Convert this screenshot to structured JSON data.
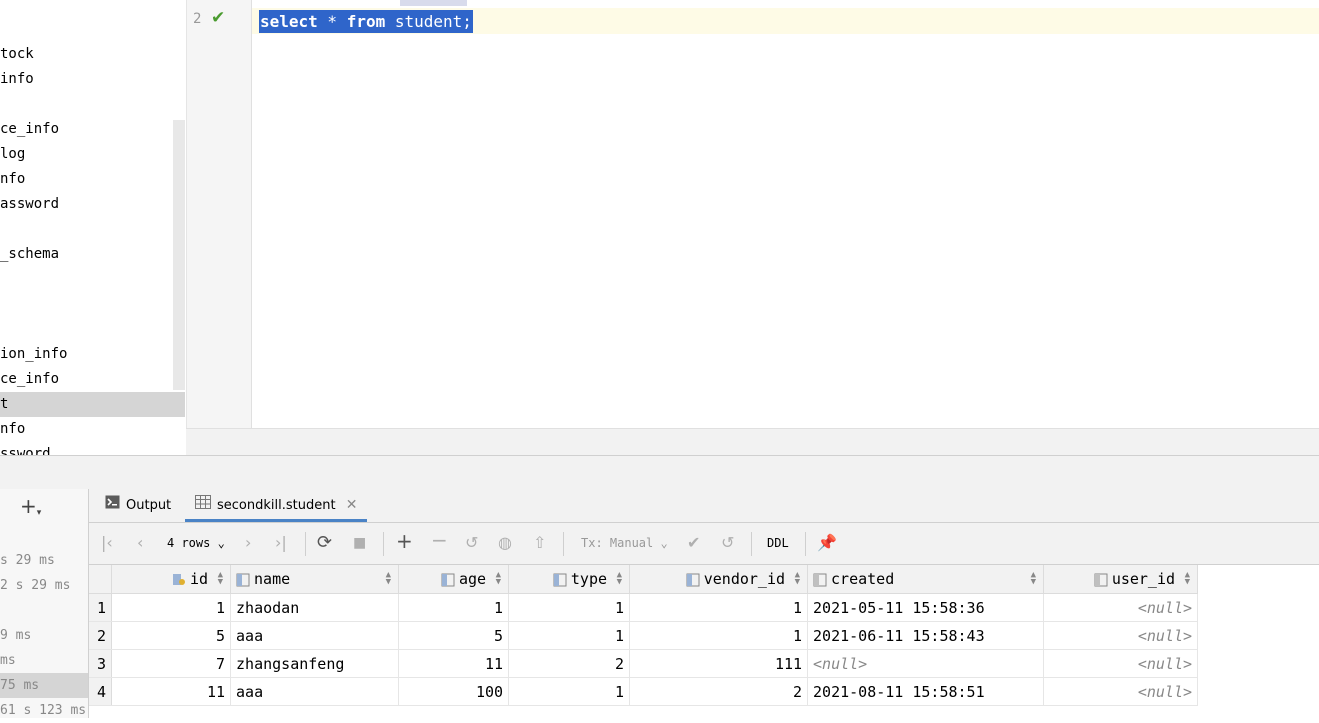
{
  "tree": {
    "items": [
      {
        "label": "tock",
        "selected": false
      },
      {
        "label": "info",
        "selected": false
      },
      {
        "label": "",
        "selected": false
      },
      {
        "label": "ce_info",
        "selected": false
      },
      {
        "label": "log",
        "selected": false
      },
      {
        "label": "nfo",
        "selected": false
      },
      {
        "label": "assword",
        "selected": false
      },
      {
        "label": "",
        "selected": false
      },
      {
        "label": "_schema",
        "selected": false
      },
      {
        "label": "",
        "selected": false
      },
      {
        "label": "",
        "selected": false
      },
      {
        "label": "",
        "selected": false
      },
      {
        "label": "ion_info",
        "selected": false
      },
      {
        "label": "ce_info",
        "selected": false
      },
      {
        "label": "t",
        "selected": true
      },
      {
        "label": "nfo",
        "selected": false
      },
      {
        "label": "ssword",
        "selected": false
      }
    ]
  },
  "editor": {
    "line_number": "2",
    "code": {
      "kw1": "select",
      "star": " * ",
      "kw2": "from",
      "rest": " student;"
    }
  },
  "services": {
    "times": [
      {
        "label": "",
        "selected": false
      },
      {
        "label": "s 29 ms",
        "selected": false
      },
      {
        "label": "2 s 29 ms",
        "selected": false
      },
      {
        "label": "",
        "selected": false
      },
      {
        "label": "9 ms",
        "selected": false
      },
      {
        "label": "ms",
        "selected": false
      },
      {
        "label": "75 ms",
        "selected": true
      },
      {
        "label": "61 s 123 ms",
        "selected": false
      }
    ]
  },
  "tabs": {
    "output": "Output",
    "result": "secondkill.student"
  },
  "toolbar": {
    "rows": "4 rows",
    "tx": "Tx: Manual",
    "ddl": "DDL"
  },
  "grid": {
    "columns": [
      "id",
      "name",
      "age",
      "type",
      "vendor_id",
      "created",
      "user_id"
    ],
    "rows": [
      {
        "n": "1",
        "id": "1",
        "name": "zhaodan",
        "age": "1",
        "type": "1",
        "vendor_id": "1",
        "created": "2021-05-11 15:58:36",
        "user_id": "<null>"
      },
      {
        "n": "2",
        "id": "5",
        "name": "aaa",
        "age": "5",
        "type": "1",
        "vendor_id": "1",
        "created": "2021-06-11 15:58:43",
        "user_id": "<null>"
      },
      {
        "n": "3",
        "id": "7",
        "name": "zhangsanfeng",
        "age": "11",
        "type": "2",
        "vendor_id": "111",
        "created": "<null>",
        "user_id": "<null>"
      },
      {
        "n": "4",
        "id": "11",
        "name": "aaa",
        "age": "100",
        "type": "1",
        "vendor_id": "2",
        "created": "2021-08-11 15:58:51",
        "user_id": "<null>"
      }
    ]
  },
  "colors": {
    "selection": "#2f65ca",
    "accent": "#4a83c6",
    "check": "#4a9b2f"
  }
}
